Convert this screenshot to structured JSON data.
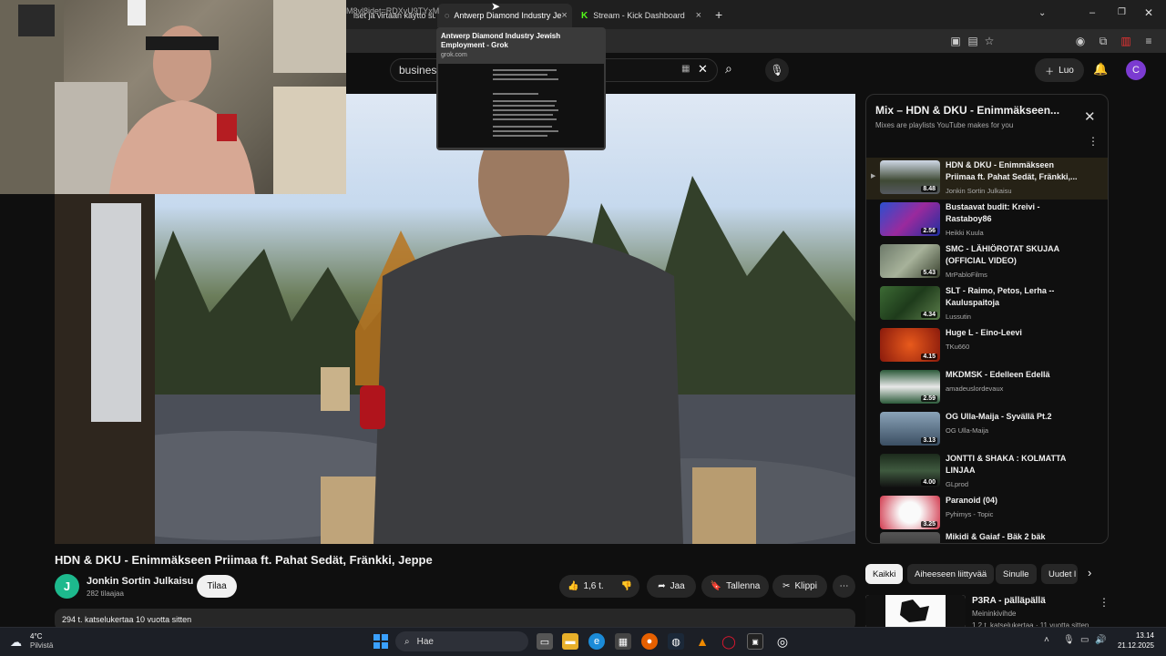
{
  "browser": {
    "tabs": [
      {
        "label": "iset ja virtaan käyttö su",
        "active": false
      },
      {
        "label": "Antwerp Diamond Industry Je",
        "active": true
      },
      {
        "label": "Stream - Kick Dashboard",
        "active": false
      }
    ],
    "new_tab": "+",
    "url": "M8vl8idet=RDXyU9TYxM",
    "tooltip": {
      "title": "Antwerp Diamond Industry Jewish Employment - Grok",
      "host": "grok.com"
    }
  },
  "youtube": {
    "search_value": "business",
    "create_label": "Luo",
    "avatar_letter": "C",
    "video": {
      "title": "HDN & DKU - Enimmäkseen Priimaa ft. Pahat Sedät, Fränkki, Jeppe",
      "channel": "Jonkin Sortin Julkaisu",
      "channel_letter": "J",
      "subscribers": "282 tilaajaa",
      "subscribe_label": "Tilaa",
      "likes": "1,6 t.",
      "share_label": "Jaa",
      "save_label": "Tallenna",
      "clip_label": "Klippi",
      "views_date": "294 t. katselukertaa  10 vuotta sitten"
    },
    "mix": {
      "title": "Mix – HDN & DKU - Enimmäkseen...",
      "subtitle": "Mixes are playlists YouTube makes for you",
      "items": [
        {
          "title": "HDN & DKU - Enimmäkseen Priimaa ft. Pahat Sedät, Fränkki,...",
          "channel": "Jonkin Sortin Julkaisu",
          "duration": "8.48",
          "active": true
        },
        {
          "title": "Bustaavat budit: Kreivi - Rastaboy86",
          "channel": "Heikki Kuula",
          "duration": "2.56",
          "active": false
        },
        {
          "title": "SMC - LÄHIÖROTAT SKUJAA (OFFICIAL VIDEO)",
          "channel": "MrPabloFilms",
          "duration": "5.43",
          "active": false
        },
        {
          "title": "SLT - Raimo, Petos, Lerha -- Kauluspaitoja",
          "channel": "Lussutin",
          "duration": "4.34",
          "active": false
        },
        {
          "title": "Huge L - Eino-Leevi",
          "channel": "TKu660",
          "duration": "4.15",
          "active": false
        },
        {
          "title": "MKDMSK - Edelleen Edellä",
          "channel": "amadeuslordevaux",
          "duration": "2.59",
          "active": false
        },
        {
          "title": "OG Ulla-Maija - Syvällä Pt.2",
          "channel": "OG Ulla-Maija",
          "duration": "3.13",
          "active": false
        },
        {
          "title": "JONTTI & SHAKA : KOLMATTA LINJAA",
          "channel": "GLprod",
          "duration": "4.00",
          "active": false
        },
        {
          "title": "Paranoid (04)",
          "channel": "Pyhimys - Topic",
          "duration": "3.25",
          "active": false
        },
        {
          "title": "Mikidi & Gaiaf - Bäk 2 bäk",
          "channel": "",
          "duration": "",
          "active": false
        }
      ]
    },
    "chips": [
      "Kaikki",
      "Aiheeseen liittyvää",
      "Sinulle",
      "Uudet l"
    ],
    "recommendation": {
      "title": "P3RA - pälläpällä",
      "channel": "Meininkivihde",
      "meta": "1,2 t. katselukertaa · 11 vuotta sitten"
    }
  },
  "taskbar": {
    "temperature": "4°C",
    "weather": "Pilvistä",
    "search_label": "Hae",
    "time": "13.14",
    "date": "21.12.2025"
  }
}
